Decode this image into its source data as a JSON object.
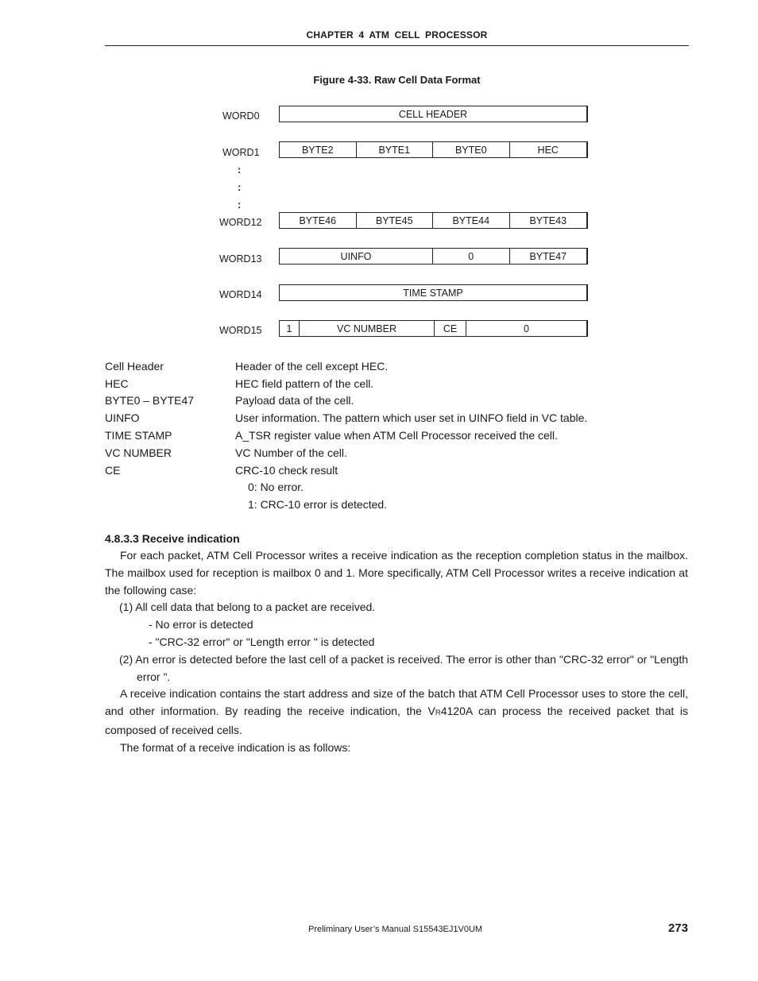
{
  "header": {
    "running_head": "CHAPTER 4 ATM CELL PROCESSOR"
  },
  "figure": {
    "title": "Figure 4-33.  Raw Cell Data Format",
    "words": [
      {
        "label": "WORD0",
        "fields": [
          {
            "text": "CELL HEADER"
          }
        ]
      },
      {
        "label": "WORD1",
        "fields": [
          {
            "text": "BYTE2"
          },
          {
            "text": "BYTE1"
          },
          {
            "text": "BYTE0"
          },
          {
            "text": "HEC"
          }
        ]
      },
      {
        "label": "WORD12",
        "fields": [
          {
            "text": "BYTE46"
          },
          {
            "text": "BYTE45"
          },
          {
            "text": "BYTE44"
          },
          {
            "text": "BYTE43"
          }
        ]
      },
      {
        "label": "WORD13",
        "fields": [
          {
            "text": "UINFO"
          },
          {
            "text": "0"
          },
          {
            "text": "BYTE47"
          }
        ]
      },
      {
        "label": "WORD14",
        "fields": [
          {
            "text": "TIME STAMP"
          }
        ]
      },
      {
        "label": "WORD15",
        "fields": [
          {
            "text": "1"
          },
          {
            "text": "VC NUMBER"
          },
          {
            "text": "CE"
          },
          {
            "text": "0"
          }
        ]
      }
    ],
    "ellipsis": ":"
  },
  "definitions": [
    {
      "term": "Cell Header",
      "desc": "Header of the cell except HEC."
    },
    {
      "term": "HEC",
      "desc": "HEC field pattern of the cell."
    },
    {
      "term": "BYTE0 – BYTE47",
      "desc": "Payload data of the cell."
    },
    {
      "term": "UINFO",
      "desc": "User information. The pattern which user set in UINFO field in VC table."
    },
    {
      "term": "TIME STAMP",
      "desc": "A_TSR register value when ATM Cell Processor received the cell."
    },
    {
      "term": "VC NUMBER",
      "desc": "VC Number of the cell."
    },
    {
      "term": "CE",
      "desc": "CRC-10 check result"
    }
  ],
  "ce_values": [
    "0: No error.",
    "1: CRC-10 error is detected."
  ],
  "section": {
    "heading": "4.8.3.3  Receive indication",
    "para1": "For each packet, ATM Cell Processor writes a receive indication as the reception completion status in the mailbox. The mailbox used for reception is mailbox 0 and 1. More specifically, ATM Cell Processor writes a receive indication at the following case:",
    "item1": "(1) All cell data that belong to a packet are received.",
    "item1_subs": [
      "- No error is detected",
      "- \"CRC-32 error\" or \"Length error \" is detected"
    ],
    "item2": "(2) An error is detected before the last cell of a packet is received. The error is other than \"CRC-32 error\" or \"Length error \".",
    "para2_before": "A receive indication contains the start address and size of the batch that ATM Cell Processor uses to store the cell, and other information. By reading the receive indication, the V",
    "para2_sub": "R",
    "para2_after": "4120A can process the received packet that is composed of received cells.",
    "para3": "The format of a receive indication is as follows:"
  },
  "footer": {
    "manual": "Preliminary User’s Manual  S15543EJ1V0UM",
    "page_number": "273"
  }
}
